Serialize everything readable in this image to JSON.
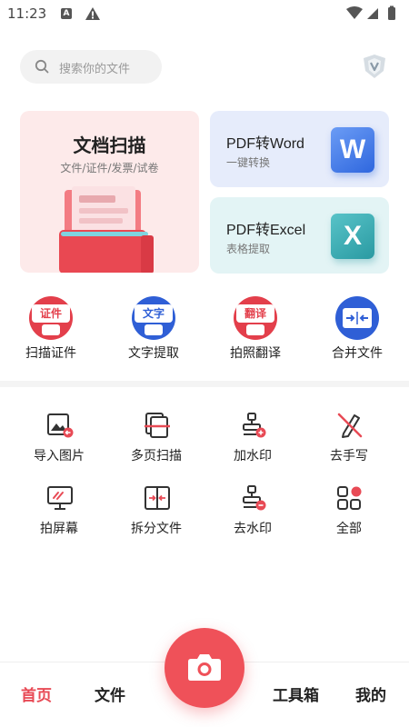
{
  "status_bar": {
    "time": "11:23",
    "notif_letter": "A"
  },
  "search": {
    "placeholder": "搜索你的文件"
  },
  "hero": {
    "scan": {
      "title": "文档扫描",
      "subtitle": "文件/证件/发票/试卷"
    },
    "word": {
      "title": "PDF转Word",
      "subtitle": "一键转换",
      "badge": "W"
    },
    "excel": {
      "title": "PDF转Excel",
      "subtitle": "表格提取",
      "badge": "X"
    }
  },
  "quick_tools": [
    {
      "label": "扫描证件",
      "tag": "证件"
    },
    {
      "label": "文字提取",
      "tag": "文字"
    },
    {
      "label": "拍照翻译",
      "tag": "翻译"
    },
    {
      "label": "合并文件"
    }
  ],
  "tools": [
    {
      "label": "导入图片",
      "icon": "import-image-icon"
    },
    {
      "label": "多页扫描",
      "icon": "multi-page-scan-icon"
    },
    {
      "label": "加水印",
      "icon": "add-watermark-icon"
    },
    {
      "label": "去手写",
      "icon": "remove-handwriting-icon"
    },
    {
      "label": "拍屏幕",
      "icon": "screen-capture-icon"
    },
    {
      "label": "拆分文件",
      "icon": "split-file-icon"
    },
    {
      "label": "去水印",
      "icon": "remove-watermark-icon"
    },
    {
      "label": "全部",
      "icon": "all-tools-icon"
    }
  ],
  "bottom_nav": {
    "home": "首页",
    "files": "文件",
    "toolbox": "工具箱",
    "mine": "我的"
  },
  "colors": {
    "accent": "#e84a55",
    "word": "#2f67de",
    "excel": "#2a9aa2"
  }
}
